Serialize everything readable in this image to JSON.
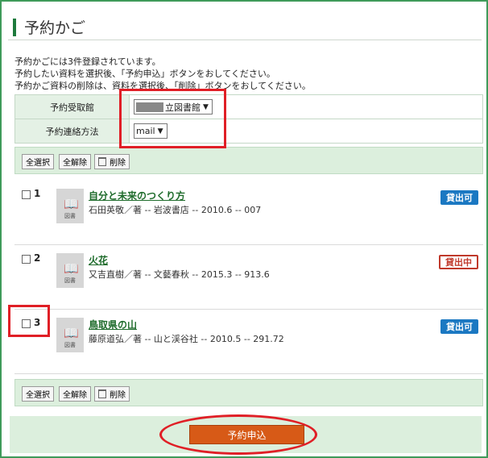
{
  "header": {
    "title": "予約かご"
  },
  "intro": {
    "line1": "予約かごには3件登録されています。",
    "line2": "予約したい資料を選択後、「予約申込」ボタンをおしてください。",
    "line3": "予約かご資料の削除は、資料を選択後、「削除」ボタンをおしてください。"
  },
  "form": {
    "pickup_label": "予約受取館",
    "pickup_value": "立図書館",
    "contact_label": "予約連絡方法",
    "contact_value": "mail"
  },
  "toolbar": {
    "select_all": "全選択",
    "deselect_all": "全解除",
    "delete": "削除"
  },
  "items": [
    {
      "num": "1",
      "title": "自分と未来のつくり方",
      "meta": "石田英敬／著 -- 岩波書店 -- 2010.6 -- 007",
      "status": "貸出可",
      "thumb_caption": "図書"
    },
    {
      "num": "2",
      "title": "火花",
      "meta": "又吉直樹／著 -- 文藝春秋 -- 2015.3 -- 913.6",
      "status": "貸出中",
      "thumb_caption": "図書"
    },
    {
      "num": "3",
      "title": "鳥取県の山",
      "meta": "藤原道弘／著 -- 山と渓谷社 -- 2010.5 -- 291.72",
      "status": "貸出可",
      "thumb_caption": "図書"
    }
  ],
  "submit_label": "予約申込",
  "colors": {
    "accent_green": "#1e7a3c",
    "available_blue": "#1b78c2",
    "checked_out_red": "#c0392b",
    "submit_orange": "#d75a17",
    "highlight_red": "#e01f26"
  }
}
